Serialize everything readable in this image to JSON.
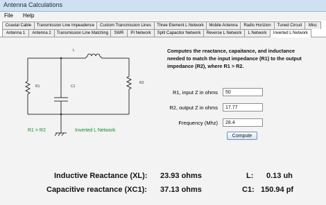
{
  "window": {
    "title": "Antenna Calculations"
  },
  "menu": [
    {
      "label": "File"
    },
    {
      "label": "Help"
    }
  ],
  "tabs_row1": [
    {
      "label": "Coaxial Cable"
    },
    {
      "label": "Transmission Line Impeadence"
    },
    {
      "label": "Custom Transmission Lines"
    },
    {
      "label": "Three Element L Network"
    },
    {
      "label": "Mobile Antenna"
    },
    {
      "label": "Radio Horizion"
    },
    {
      "label": "Tuned Circuit"
    },
    {
      "label": "Misc"
    }
  ],
  "tabs_row2": [
    {
      "label": "Antenna 1"
    },
    {
      "label": "Antenna 2"
    },
    {
      "label": "Transmission Line Matching"
    },
    {
      "label": "SWR"
    },
    {
      "label": "PI Network"
    },
    {
      "label": "Split Capacitor Network"
    },
    {
      "label": "Reverse L Network"
    },
    {
      "label": "L Network"
    },
    {
      "label": "Inverted L Network",
      "active": true
    }
  ],
  "schematic": {
    "labels": {
      "L": "L",
      "R1": "R1",
      "C1": "C1",
      "R2": "R2"
    },
    "condition": "R1 > R2",
    "network_name": "Inverted L Network"
  },
  "description": "Computes the reactance, capaitance, and inductance needed to match the input impedance (R1) to the output impedance (R2), where R1 > R2.",
  "form": {
    "r1": {
      "label": "R1, input Z in ohms",
      "value": "50"
    },
    "r2": {
      "label": "R2, output Z in ohms",
      "value": "17.77"
    },
    "freq": {
      "label": "Frequency (Mhz)",
      "value": "28.4"
    },
    "compute_label": "Compute"
  },
  "results": {
    "xl_label": "Inductive Reactance (XL):",
    "xl_value": "23.93 ohms",
    "l_label": "L:",
    "l_value": "0.13 uh",
    "xc_label": "Capacitive reactance (XC1):",
    "xc_value": "37.13 ohms",
    "c_label": "C1:",
    "c_value": "150.94 pf"
  }
}
